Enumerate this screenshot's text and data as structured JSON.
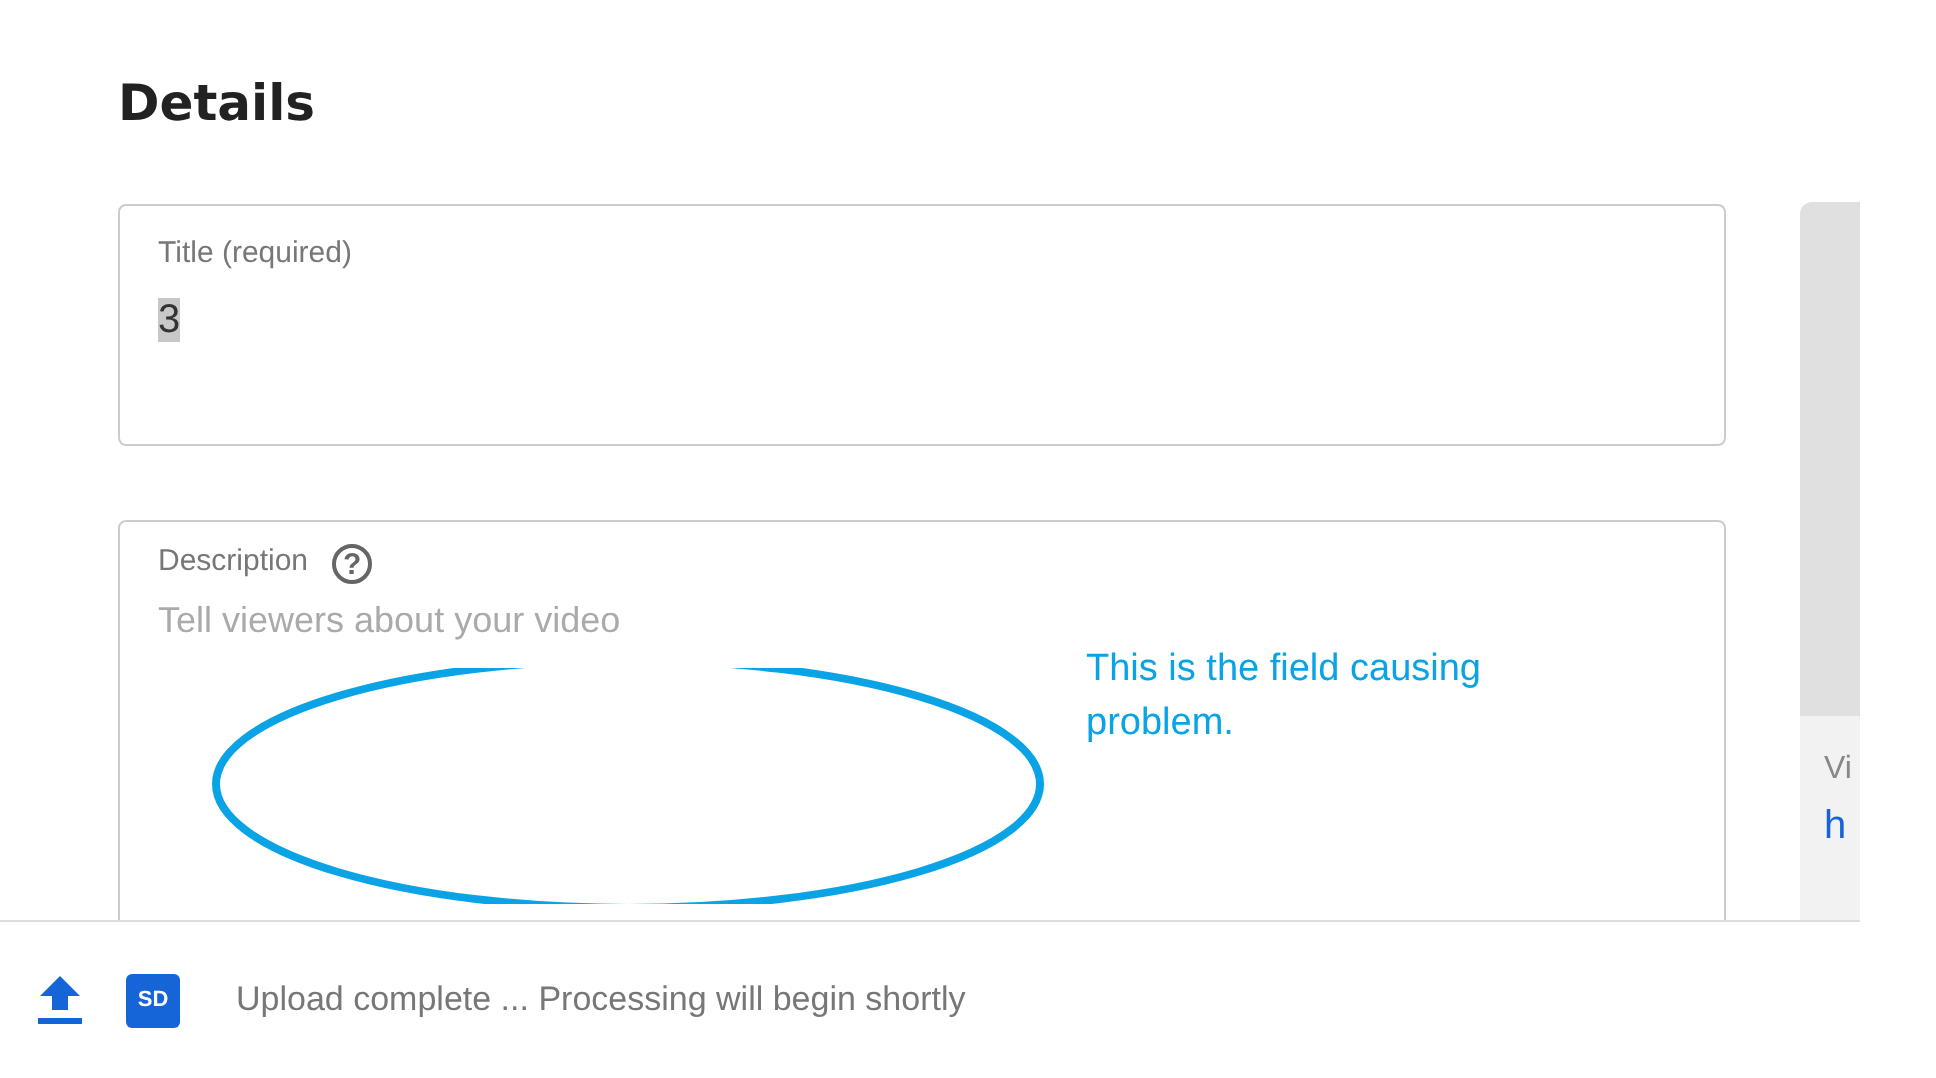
{
  "heading": "Details",
  "title_field": {
    "label": "Title (required)",
    "value": "3",
    "value_selected": true
  },
  "description_field": {
    "label": "Description",
    "help_icon": "?",
    "placeholder": "Tell viewers about your video"
  },
  "side_panel": {
    "label": "Vi",
    "link": "h"
  },
  "annotation": {
    "text": "This is the field causing problem."
  },
  "status_bar": {
    "quality_badge": "SD",
    "message": "Upload complete ... Processing will begin shortly"
  }
}
